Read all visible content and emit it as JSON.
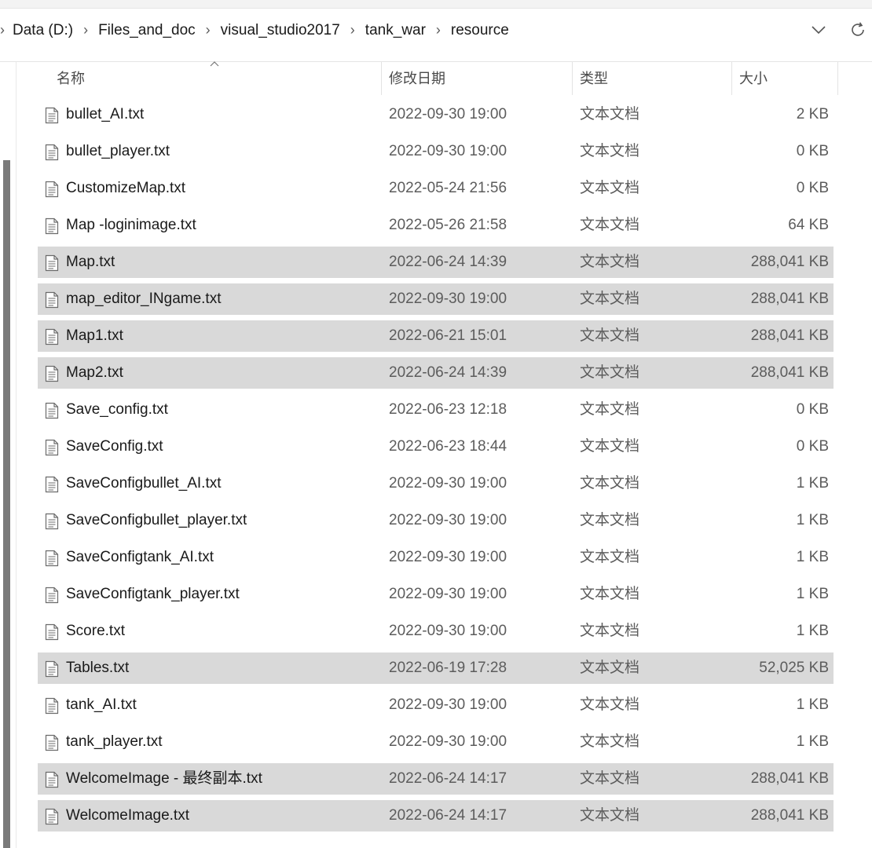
{
  "breadcrumb": {
    "items": [
      "Data (D:)",
      "Files_and_doc",
      "visual_studio2017",
      "tank_war",
      "resource"
    ]
  },
  "address_bar": {
    "dropdown_icon": "chevron-down-icon",
    "refresh_icon": "refresh-icon"
  },
  "columns": {
    "name": "名称",
    "date": "修改日期",
    "type": "类型",
    "size": "大小"
  },
  "files": [
    {
      "name": "bullet_AI.txt",
      "date": "2022-09-30 19:00",
      "type": "文本文档",
      "size": "2 KB",
      "selected": false
    },
    {
      "name": "bullet_player.txt",
      "date": "2022-09-30 19:00",
      "type": "文本文档",
      "size": "0 KB",
      "selected": false
    },
    {
      "name": "CustomizeMap.txt",
      "date": "2022-05-24 21:56",
      "type": "文本文档",
      "size": "0 KB",
      "selected": false
    },
    {
      "name": "Map -loginimage.txt",
      "date": "2022-05-26 21:58",
      "type": "文本文档",
      "size": "64 KB",
      "selected": false
    },
    {
      "name": "Map.txt",
      "date": "2022-06-24 14:39",
      "type": "文本文档",
      "size": "288,041 KB",
      "selected": true
    },
    {
      "name": "map_editor_INgame.txt",
      "date": "2022-09-30 19:00",
      "type": "文本文档",
      "size": "288,041 KB",
      "selected": true
    },
    {
      "name": "Map1.txt",
      "date": "2022-06-21 15:01",
      "type": "文本文档",
      "size": "288,041 KB",
      "selected": true
    },
    {
      "name": "Map2.txt",
      "date": "2022-06-24 14:39",
      "type": "文本文档",
      "size": "288,041 KB",
      "selected": true
    },
    {
      "name": "Save_config.txt",
      "date": "2022-06-23 12:18",
      "type": "文本文档",
      "size": "0 KB",
      "selected": false
    },
    {
      "name": "SaveConfig.txt",
      "date": "2022-06-23 18:44",
      "type": "文本文档",
      "size": "0 KB",
      "selected": false
    },
    {
      "name": "SaveConfigbullet_AI.txt",
      "date": "2022-09-30 19:00",
      "type": "文本文档",
      "size": "1 KB",
      "selected": false
    },
    {
      "name": "SaveConfigbullet_player.txt",
      "date": "2022-09-30 19:00",
      "type": "文本文档",
      "size": "1 KB",
      "selected": false
    },
    {
      "name": "SaveConfigtank_AI.txt",
      "date": "2022-09-30 19:00",
      "type": "文本文档",
      "size": "1 KB",
      "selected": false
    },
    {
      "name": "SaveConfigtank_player.txt",
      "date": "2022-09-30 19:00",
      "type": "文本文档",
      "size": "1 KB",
      "selected": false
    },
    {
      "name": "Score.txt",
      "date": "2022-09-30 19:00",
      "type": "文本文档",
      "size": "1 KB",
      "selected": false
    },
    {
      "name": "Tables.txt",
      "date": "2022-06-19 17:28",
      "type": "文本文档",
      "size": "52,025 KB",
      "selected": true
    },
    {
      "name": "tank_AI.txt",
      "date": "2022-09-30 19:00",
      "type": "文本文档",
      "size": "1 KB",
      "selected": false
    },
    {
      "name": "tank_player.txt",
      "date": "2022-09-30 19:00",
      "type": "文本文档",
      "size": "1 KB",
      "selected": false
    },
    {
      "name": "WelcomeImage - 最终副本.txt",
      "date": "2022-06-24 14:17",
      "type": "文本文档",
      "size": "288,041 KB",
      "selected": true
    },
    {
      "name": "WelcomeImage.txt",
      "date": "2022-06-24 14:17",
      "type": "文本文档",
      "size": "288,041 KB",
      "selected": true
    }
  ],
  "colors": {
    "selected_row": "#d9d9d9",
    "scrollbar_thumb": "#7a7a7a",
    "secondary_text": "#5c5c5c"
  }
}
